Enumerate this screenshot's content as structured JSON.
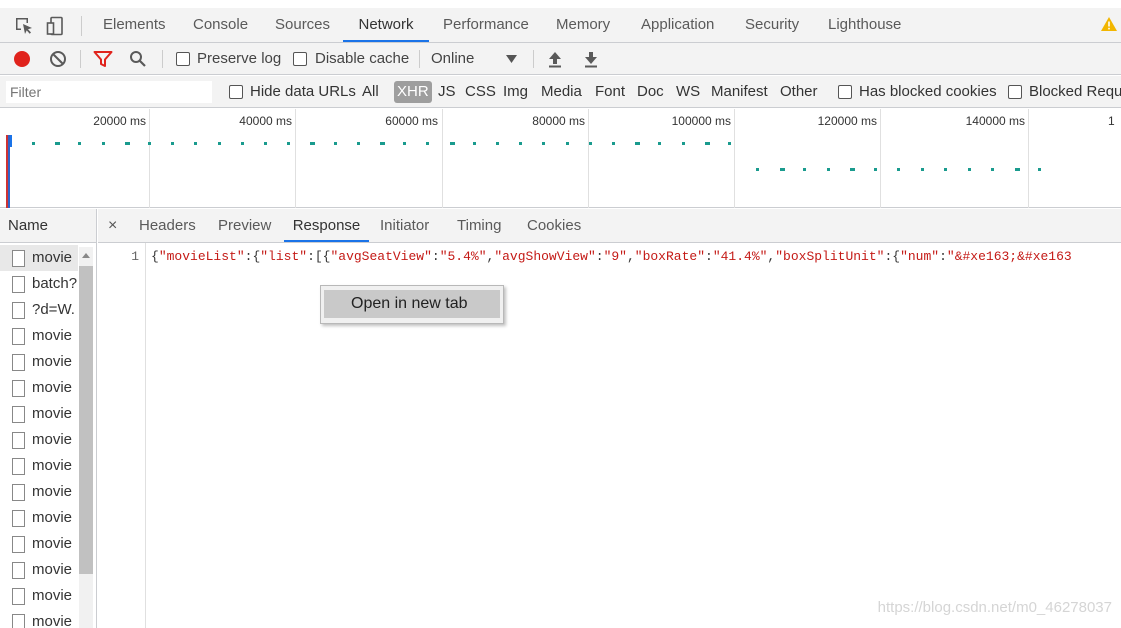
{
  "topTabs": [
    "Elements",
    "Console",
    "Sources",
    "Network",
    "Performance",
    "Memory",
    "Application",
    "Security",
    "Lighthouse"
  ],
  "activeTopTab": "Network",
  "toolbar": {
    "preserve_log": "Preserve log",
    "disable_cache": "Disable cache",
    "throttle": "Online"
  },
  "filterbar": {
    "filter_placeholder": "Filter",
    "hide_data_urls": "Hide data URLs",
    "types": [
      "All",
      "XHR",
      "JS",
      "CSS",
      "Img",
      "Media",
      "Font",
      "Doc",
      "WS",
      "Manifest",
      "Other"
    ],
    "active_type": "XHR",
    "has_blocked_cookies": "Has blocked cookies",
    "blocked_requests": "Blocked Reque"
  },
  "overview": {
    "ticks": [
      "20000 ms",
      "40000 ms",
      "60000 ms",
      "80000 ms",
      "100000 ms",
      "120000 ms",
      "140000 ms",
      "1"
    ]
  },
  "requests": {
    "header": "Name",
    "items": [
      "movie",
      "batch?",
      "?d=W.",
      "movie",
      "movie",
      "movie",
      "movie",
      "movie",
      "movie",
      "movie",
      "movie",
      "movie",
      "movie",
      "movie",
      "movie"
    ]
  },
  "detail": {
    "close": "×",
    "tabs": [
      "Headers",
      "Preview",
      "Response",
      "Initiator",
      "Timing",
      "Cookies"
    ],
    "active_tab": "Response",
    "line_number": "1",
    "response_line": "{\"movieList\":{\"list\":[{\"avgSeatView\":\"5.4%\",\"avgShowView\":\"9\",\"boxRate\":\"41.4%\",\"boxSplitUnit\":{\"num\":\"&#xe163;&#xe163"
  },
  "context_menu": {
    "item": "Open in new tab"
  },
  "watermark": "https://blog.csdn.net/m0_46278037"
}
